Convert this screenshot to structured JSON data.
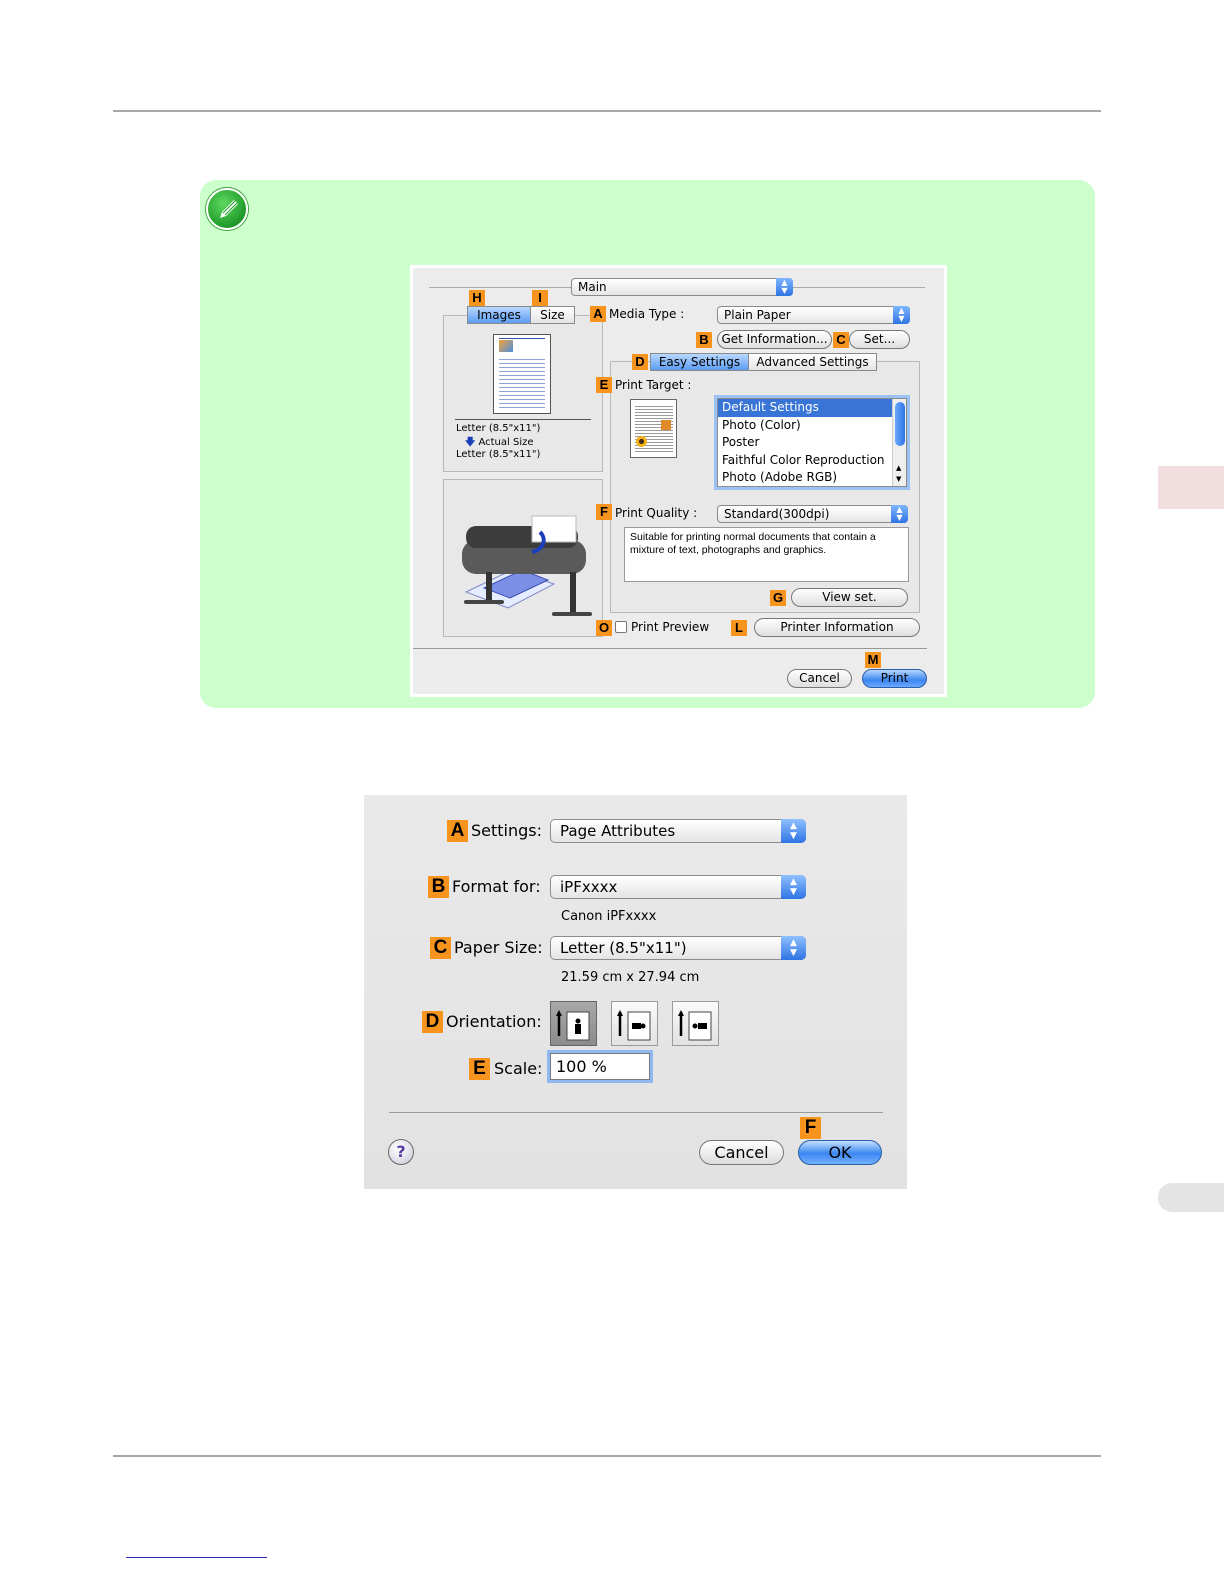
{
  "note_dialog": {
    "main_popup": "Main",
    "tags": {
      "A": "A",
      "B": "B",
      "C": "C",
      "D": "D",
      "E": "E",
      "F": "F",
      "G": "G",
      "H": "H",
      "I": "I",
      "L": "L",
      "M": "M",
      "O": "O"
    },
    "tabs": {
      "images": "Images",
      "size": "Size"
    },
    "preview_info": [
      "Letter (8.5\"x11\")",
      "Actual Size",
      "Letter (8.5\"x11\")"
    ],
    "media_type_label": "Media Type :",
    "media_type_value": "Plain Paper",
    "get_information_button": "Get Information...",
    "set_button": "Set...",
    "settings_tabs": {
      "easy": "Easy Settings",
      "advanced": "Advanced Settings"
    },
    "print_target_label": "Print Target :",
    "print_targets": [
      "Default Settings",
      "Photo (Color)",
      "Poster",
      "Faithful Color Reproduction",
      "Photo (Adobe RGB)"
    ],
    "print_quality_label": "Print Quality :",
    "print_quality_value": "Standard(300dpi)",
    "description": "Suitable for printing normal documents that contain a mixture of text, photographs and graphics.",
    "view_set_button": "View set.",
    "print_preview_label": "Print Preview",
    "printer_information_button": "Printer Information",
    "cancel_button": "Cancel",
    "print_button": "Print",
    "colors": {
      "note_bg": "#ccffcc",
      "tag": "#f7941d",
      "selection": "#3875d7"
    }
  },
  "page_setup_dialog": {
    "tags": {
      "A": "A",
      "B": "B",
      "C": "C",
      "D": "D",
      "E": "E",
      "F": "F"
    },
    "settings_label": "Settings:",
    "settings_value": "Page Attributes",
    "format_for_label": "Format for:",
    "format_for_value": "iPFxxxx",
    "format_for_sub": "Canon iPFxxxx",
    "paper_size_label": "Paper Size:",
    "paper_size_value": "Letter (8.5\"x11\")",
    "paper_size_sub": "21.59 cm x 27.94 cm",
    "orientation_label": "Orientation:",
    "scale_label": "Scale:",
    "scale_value": "100 %",
    "help_button": "?",
    "cancel_button": "Cancel",
    "ok_button": "OK"
  }
}
